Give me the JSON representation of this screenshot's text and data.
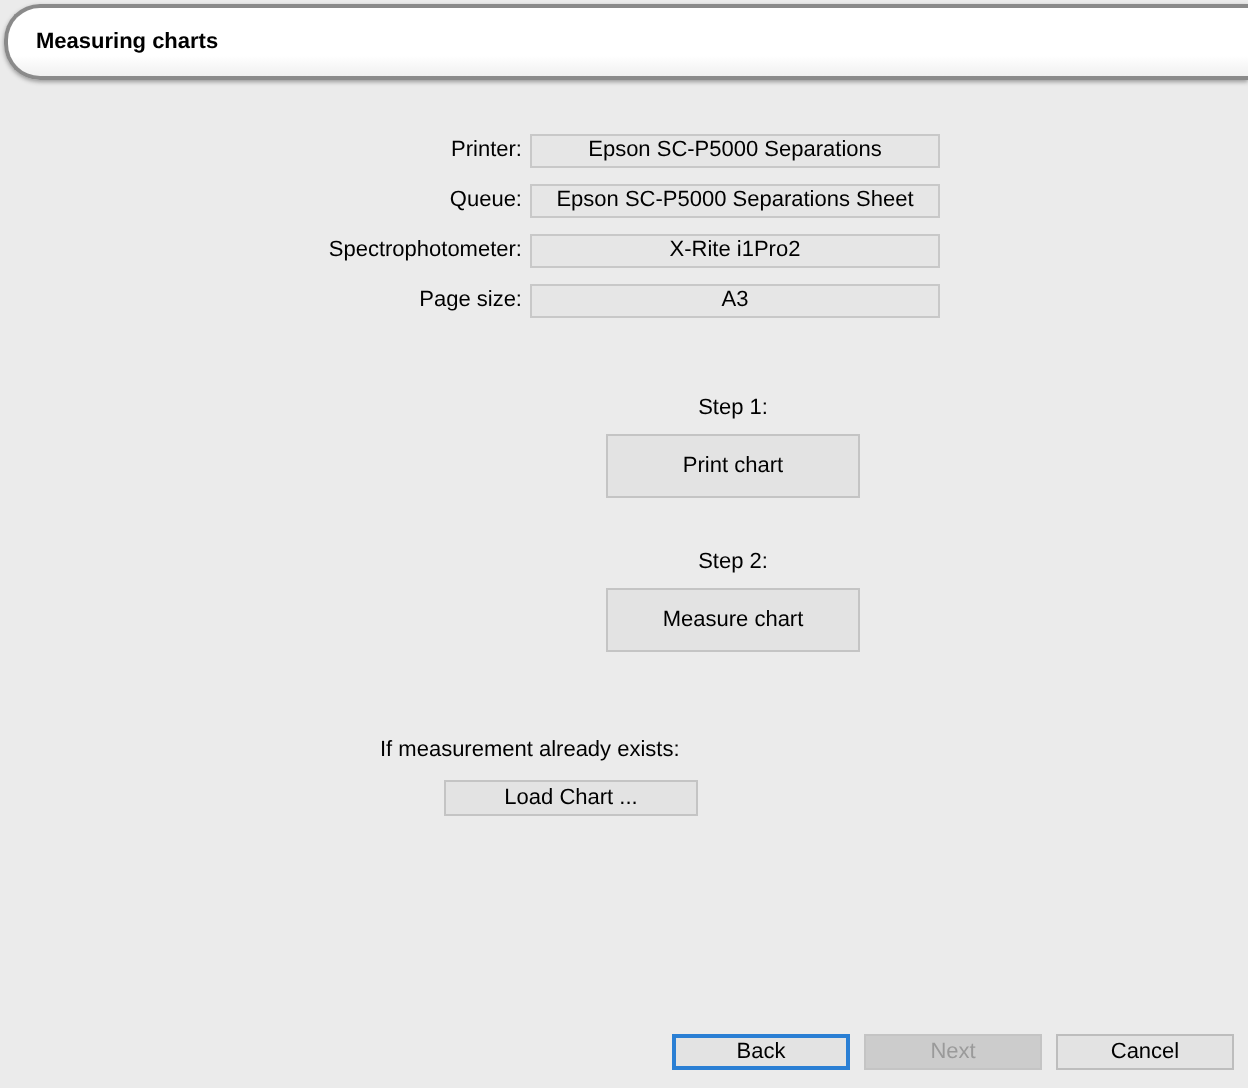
{
  "header": {
    "title": "Measuring charts"
  },
  "fields": [
    {
      "label": "Printer:",
      "value": "Epson SC-P5000 Separations"
    },
    {
      "label": "Queue:",
      "value": "Epson SC-P5000 Separations Sheet"
    },
    {
      "label": "Spectrophotometer:",
      "value": "X-Rite i1Pro2"
    },
    {
      "label": "Page size:",
      "value": "A3"
    }
  ],
  "steps": [
    {
      "label": "Step 1:",
      "button": "Print chart"
    },
    {
      "label": "Step 2:",
      "button": "Measure chart"
    }
  ],
  "existing": {
    "label": "If measurement already exists:",
    "button": "Load Chart ..."
  },
  "footer_buttons": [
    {
      "label": "Back",
      "default": true,
      "disabled": false
    },
    {
      "label": "Next",
      "default": false,
      "disabled": true
    },
    {
      "label": "Cancel",
      "default": false,
      "disabled": false
    }
  ]
}
